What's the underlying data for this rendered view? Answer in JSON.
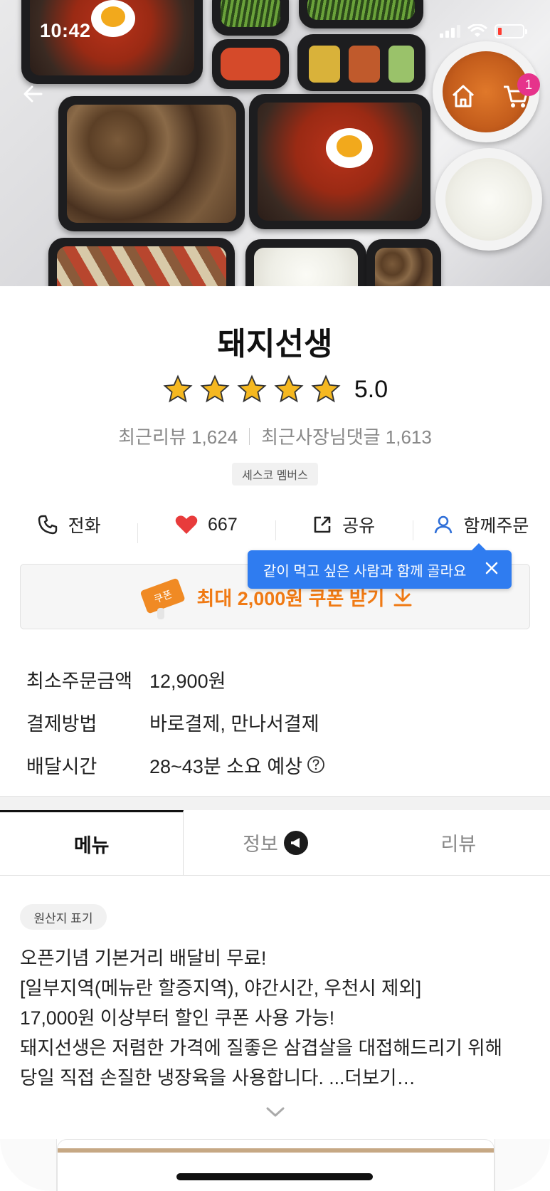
{
  "status_bar": {
    "time": "10:42"
  },
  "header": {
    "cart_count": "1"
  },
  "store": {
    "name": "돼지선생",
    "rating": "5.0",
    "recent_reviews": "최근리뷰 1,624",
    "owner_replies": "최근사장님댓글 1,613",
    "tag": "세스코 멤버스"
  },
  "actions": {
    "call": "전화",
    "likes": "667",
    "share": "공유",
    "group_order": "함께주문"
  },
  "tooltip": {
    "text": "같이 먹고 싶은 사람과 함께 골라요"
  },
  "coupon": {
    "icon_text": "쿠폰",
    "label": "최대 2,000원 쿠폰 받기"
  },
  "info": [
    {
      "key": "최소주문금액",
      "value": "12,900원"
    },
    {
      "key": "결제방법",
      "value": "바로결제, 만나서결제"
    },
    {
      "key": "배달시간",
      "value": "28~43분 소요 예상"
    }
  ],
  "tabs": [
    {
      "label": "메뉴"
    },
    {
      "label": "정보"
    },
    {
      "label": "리뷰"
    }
  ],
  "origin_label": "원산지 표기",
  "notice_lines": [
    "오픈기념 기본거리 배달비 무료!",
    "[일부지역(메뉴란 할증지역), 야간시간, 우천시 제외]",
    "17,000원 이상부터 할인 쿠폰 사용 가능!",
    "돼지선생은 저렴한 가격에 질좋은 삼겹살을 대접해드리기 위해",
    "당일 직접 손질한 냉장육을 사용합니다. ...더보기…"
  ],
  "colors": {
    "accent_orange": "#f07a14",
    "tooltip_blue": "#2f7cf0",
    "badge_pink": "#e6338b",
    "heart_red": "#e83b3b"
  }
}
